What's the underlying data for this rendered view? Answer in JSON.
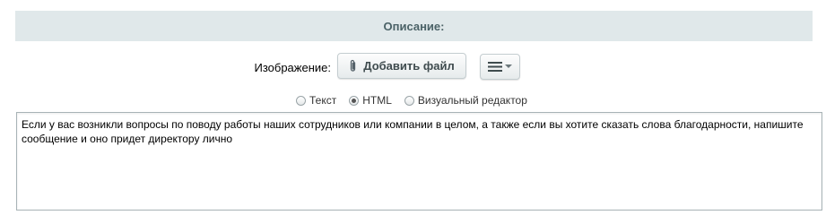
{
  "section": {
    "title": "Описание:"
  },
  "image_field": {
    "label": "Изображение:",
    "add_file_label": "Добавить файл"
  },
  "editor_modes": [
    {
      "label": "Текст",
      "selected": false
    },
    {
      "label": "HTML",
      "selected": true
    },
    {
      "label": "Визуальный редактор",
      "selected": false
    }
  ],
  "description_text": "Если у вас возникли вопросы по поводу работы наших сотрудников или компании в целом, а также если вы хотите сказать слова благодарности, напишите сообщение и оно придет директору лично",
  "icons": {
    "attach": "paperclip-icon",
    "menu": "hamburger-menu-icon",
    "dropdown": "caret-down-icon"
  },
  "colors": {
    "header_bg": "#e0e8ea",
    "header_text": "#4b6267",
    "button_text": "#3f4b4e"
  }
}
